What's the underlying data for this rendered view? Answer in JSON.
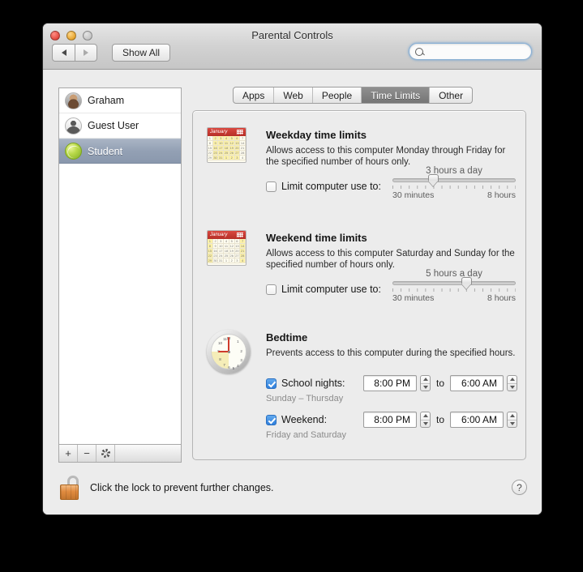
{
  "window": {
    "title": "Parental Controls",
    "traffic_lights": [
      "close",
      "minimize",
      "zoom"
    ],
    "back_label": "◀",
    "forward_label": "▶",
    "show_all_label": "Show All",
    "search_placeholder": "",
    "search_value": ""
  },
  "sidebar": {
    "users": [
      {
        "name": "Graham",
        "avatar": "photo-avatar",
        "selected": false
      },
      {
        "name": "Guest User",
        "avatar": "guest-silhouette-avatar",
        "selected": false
      },
      {
        "name": "Student",
        "avatar": "tennis-ball-avatar",
        "selected": true
      }
    ],
    "footer": {
      "add_label": "+",
      "remove_label": "−",
      "action_icon": "gear-icon"
    }
  },
  "tabs": [
    {
      "label": "Apps",
      "active": false
    },
    {
      "label": "Web",
      "active": false
    },
    {
      "label": "People",
      "active": false
    },
    {
      "label": "Time Limits",
      "active": true
    },
    {
      "label": "Other",
      "active": false
    }
  ],
  "weekday": {
    "icon": "calendar-january-weekday-icon",
    "calendar_month": "January",
    "title": "Weekday time limits",
    "description": "Allows access to this computer Monday through Friday for the specified number of hours only.",
    "checkbox_label": "Limit computer use to:",
    "checked": false,
    "slider_value_label": "3 hours a day",
    "slider_min_label": "30 minutes",
    "slider_max_label": "8 hours",
    "slider_percent": 33
  },
  "weekend": {
    "icon": "calendar-january-weekend-icon",
    "calendar_month": "January",
    "title": "Weekend time limits",
    "description": "Allows access to this computer Saturday and Sunday for the specified number of hours only.",
    "checkbox_label": "Limit computer use to:",
    "checked": false,
    "slider_value_label": "5 hours a day",
    "slider_min_label": "30 minutes",
    "slider_max_label": "8 hours",
    "slider_percent": 60
  },
  "bedtime": {
    "icon": "analog-clock-icon",
    "title": "Bedtime",
    "description": "Prevents access to this computer during the specified hours.",
    "to_word": "to",
    "rows": [
      {
        "label": "School nights:",
        "sublabel": "Sunday – Thursday",
        "checked": true,
        "start_time": "8:00 PM",
        "end_time": "6:00 AM"
      },
      {
        "label": "Weekend:",
        "sublabel": "Friday and Saturday",
        "checked": true,
        "start_time": "8:00 PM",
        "end_time": "6:00 AM"
      }
    ]
  },
  "lockbar": {
    "icon": "open-padlock-icon",
    "text": "Click the lock to prevent further changes.",
    "help_label": "?"
  },
  "calendar_days": {
    "row1": [
      "1",
      "2",
      "3",
      "4",
      "5",
      "6",
      "7"
    ],
    "row2": [
      "8",
      "9",
      "10",
      "11",
      "12",
      "13",
      "14"
    ],
    "row3": [
      "15",
      "16",
      "17",
      "18",
      "19",
      "20",
      "21"
    ],
    "row4": [
      "22",
      "23",
      "24",
      "25",
      "26",
      "27",
      "28"
    ],
    "row5": [
      "29",
      "30",
      "31",
      "1",
      "2",
      "3",
      "4"
    ]
  },
  "clock_numerals": [
    "12",
    "1",
    "2",
    "3",
    "4",
    "5",
    "6",
    "7",
    "8",
    "9",
    "10",
    "11"
  ],
  "colors": {
    "accent": "#2f7fdc",
    "selection": "#93a0b4",
    "calendar_header": "#c4362e",
    "calendar_highlight": "#fdf2a8",
    "lock_orange": "#e08b3f"
  }
}
